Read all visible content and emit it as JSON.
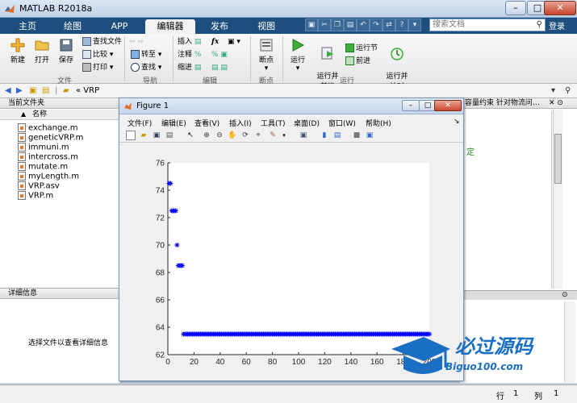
{
  "window": {
    "title": "MATLAB R2018a"
  },
  "tabs": [
    {
      "label": "主页"
    },
    {
      "label": "绘图"
    },
    {
      "label": "APP"
    },
    {
      "label": "编辑器"
    },
    {
      "label": "发布"
    },
    {
      "label": "视图"
    }
  ],
  "search": {
    "placeholder": "搜索文档"
  },
  "login_label": "登录",
  "ribbon": {
    "file": {
      "new": "新建",
      "open": "打开",
      "save": "保存",
      "find_files": "查找文件",
      "compare": "比较",
      "print": "打印",
      "group": "文件"
    },
    "navigate": {
      "goto": "转至",
      "find": "查找",
      "group": "导航"
    },
    "edit": {
      "insert": "插入",
      "fx": "fx",
      "comment": "注释",
      "indent": "缩进",
      "group": "编辑"
    },
    "breakpoints": {
      "label": "断点",
      "group": "断点"
    },
    "run": {
      "run": "运行",
      "run_advance": "运行并\n前进",
      "run_section": "运行节",
      "advance": "前进",
      "run_time": "运行并\n计时",
      "group": "运行"
    }
  },
  "address": {
    "path": "« VRP",
    "right_text": "容量约束 针对物流问…"
  },
  "current_folder": {
    "header": "当前文件夹",
    "column_name": "名称",
    "files": [
      "exchange.m",
      "geneticVRP.m",
      "immuni.m",
      "intercross.m",
      "mutate.m",
      "myLength.m",
      "VRP.asv",
      "VRP.m"
    ]
  },
  "details": {
    "header": "详细信息",
    "message": "选择文件以查看详细信息"
  },
  "editor_fragment": "定",
  "status": {
    "row_label": "行",
    "row_value": "1",
    "col_label": "列",
    "col_value": "1"
  },
  "figure": {
    "title": "Figure 1",
    "menu": [
      "文件(F)",
      "编辑(E)",
      "查看(V)",
      "插入(I)",
      "工具(T)",
      "桌面(D)",
      "窗口(W)",
      "帮助(H)"
    ]
  },
  "watermark": {
    "cn": "必过源码",
    "en": "Biguo100.com"
  },
  "colors": {
    "marker": "#0000ff",
    "tabbar": "#1d4e7e"
  },
  "chart_data": {
    "type": "scatter",
    "marker": "*",
    "xlim": [
      0,
      200
    ],
    "ylim": [
      62,
      76
    ],
    "xticks": [
      0,
      20,
      40,
      60,
      80,
      100,
      120,
      140,
      160,
      180,
      200
    ],
    "yticks": [
      62,
      64,
      66,
      68,
      70,
      72,
      74,
      76
    ],
    "series": [
      {
        "x": [
          1,
          2,
          3,
          4
        ],
        "y": [
          74.5,
          74.5,
          72.5,
          72.5
        ]
      },
      {
        "x": [
          5,
          6
        ],
        "y": [
          72.5,
          72.5
        ]
      },
      {
        "x": [
          7
        ],
        "y": [
          70
        ]
      },
      {
        "x": [
          8,
          9,
          10,
          11
        ],
        "y": [
          68.5,
          68.5,
          68.5,
          68.5
        ]
      },
      {
        "x_range": [
          12,
          200
        ],
        "y": 63.5
      }
    ]
  }
}
